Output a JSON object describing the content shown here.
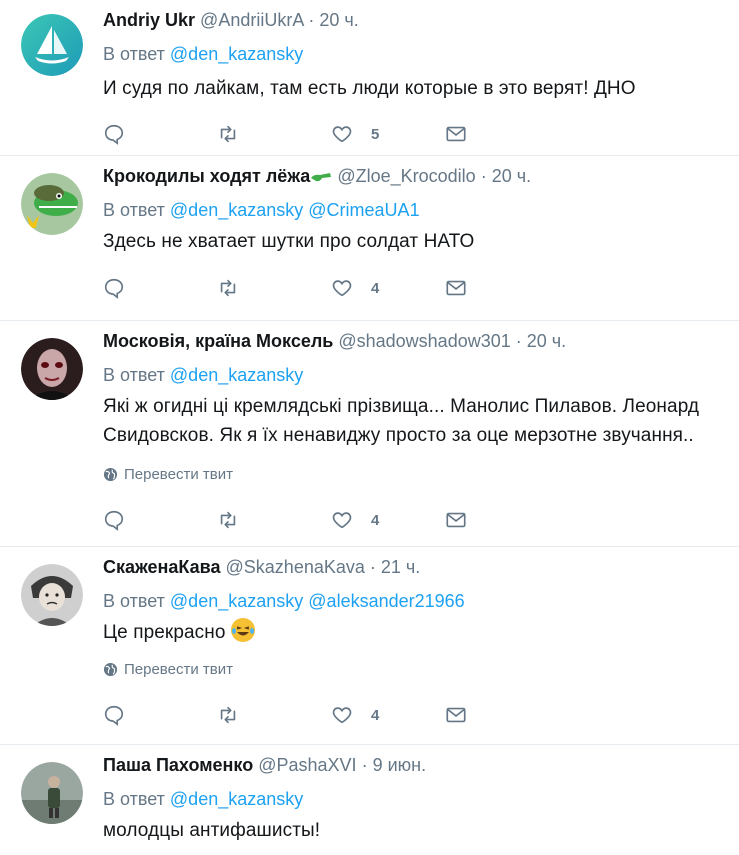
{
  "tweets": [
    {
      "fullname": "Andriy Ukr",
      "handle": "@AndriiUkrA",
      "time": "20 ч.",
      "reply_prefix": "В ответ",
      "mentions": [
        "@den_kazansky"
      ],
      "text": "И судя по лайкам, там есть люди которые в это верят! ДНО",
      "likes": "5",
      "translate": "",
      "avatar": "sailboat-logo-avatar"
    },
    {
      "fullname": "Крокодилы ходят лёжа",
      "handle": "@Zloe_Krocodilo",
      "time": "20 ч.",
      "reply_prefix": "В ответ",
      "mentions": [
        "@den_kazansky",
        "@CrimeaUA1"
      ],
      "text": "Здесь не хватает шутки про солдат НАТО",
      "likes": "4",
      "translate": "",
      "avatar": "crocodile-avatar"
    },
    {
      "fullname": "Московія, країна Моксель",
      "handle": "@shadowshadow301",
      "time": "20 ч.",
      "reply_prefix": "В ответ",
      "mentions": [
        "@den_kazansky"
      ],
      "text": "Які ж огидні ці кремлядські прізвища... Манолис Пилавов. Леонард Свидовсков. Як я їх ненавиджу просто за оце мерзотне звучання..",
      "likes": "4",
      "translate": "Перевести твит",
      "avatar": "face-avatar"
    },
    {
      "fullname": "СкаженаКава",
      "handle": "@SkazhenaKava",
      "time": "21 ч.",
      "reply_prefix": "В ответ",
      "mentions": [
        "@den_kazansky",
        "@aleksander21966"
      ],
      "text": "Це прекрасно",
      "likes": "4",
      "translate": "Перевести твит",
      "avatar": "child-photo-avatar"
    },
    {
      "fullname": "Паша Пахоменко",
      "handle": "@PashaXVI",
      "time": "9 июн.",
      "reply_prefix": "В ответ",
      "mentions": [
        "@den_kazansky"
      ],
      "text": "молодцы антифашисты!",
      "likes": "",
      "translate": "",
      "avatar": "person-photo-avatar"
    }
  ],
  "colors": {
    "link": "#1da1f2",
    "muted": "#657786",
    "border": "#e6ecf0"
  }
}
